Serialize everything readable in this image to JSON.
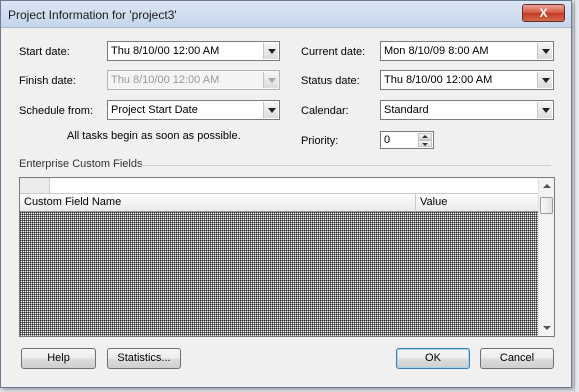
{
  "window": {
    "title": "Project Information for 'project3'",
    "close_label": "X"
  },
  "fields": {
    "start_date": {
      "label": "Start date:",
      "value": "Thu 8/10/00 12:00 AM"
    },
    "finish_date": {
      "label": "Finish date:",
      "value": "Thu 8/10/00 12:00 AM"
    },
    "schedule_from": {
      "label": "Schedule from:",
      "value": "Project Start Date"
    },
    "schedule_note": "All tasks begin as soon as possible.",
    "current_date": {
      "label": "Current date:",
      "value": "Mon 8/10/09 8:00 AM"
    },
    "status_date": {
      "label": "Status date:",
      "value": "Thu 8/10/00 12:00 AM"
    },
    "calendar": {
      "label": "Calendar:",
      "value": "Standard"
    },
    "priority": {
      "label": "Priority:",
      "value": "0"
    }
  },
  "enterprise": {
    "title": "Enterprise Custom Fields",
    "columns": [
      "Custom Field Name",
      "Value"
    ]
  },
  "buttons": {
    "help": "Help",
    "statistics": "Statistics...",
    "ok": "OK",
    "cancel": "Cancel"
  },
  "colors": {
    "close_button": "#c23a22",
    "titlebar": "#c6d6ec",
    "dialog_bg": "#f0f0f0"
  }
}
